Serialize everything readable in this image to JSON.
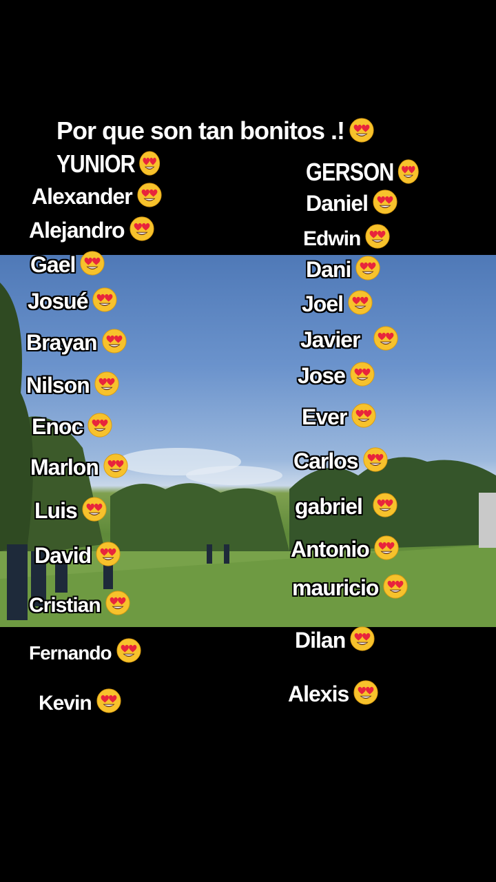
{
  "title": "Por que son tan bonitos .!",
  "left_names": [
    "YUNIOR",
    "Alexander",
    "Alejandro",
    "Gael",
    "Josué",
    "Brayan",
    "Nilson",
    "Enoc",
    "Marlon",
    "Luis",
    "David",
    "Cristian",
    "Fernando",
    "Kevin"
  ],
  "right_names": [
    "GERSON",
    "Daniel",
    "Edwin",
    "Dani",
    "Joel",
    "Javier",
    "Jose",
    "Ever",
    "Carlos",
    "gabriel",
    "Antonio",
    "mauricio",
    "Dilan",
    "Alexis"
  ],
  "emoji": "heart-eyes-emoji",
  "colors": {
    "background": "#000000",
    "text": "#ffffff",
    "sky": "#5b84c0",
    "grass": "#6f9a44"
  }
}
